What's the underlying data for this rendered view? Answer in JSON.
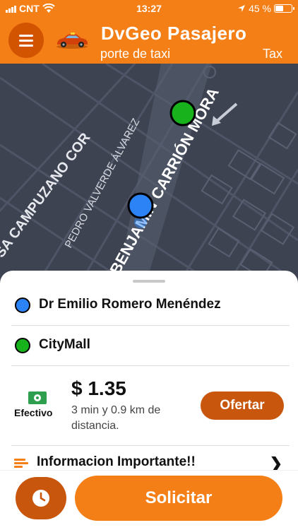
{
  "status_bar": {
    "carrier": "CNT",
    "time": "13:27",
    "battery_text": "45 %",
    "battery_level": 0.45
  },
  "header": {
    "title": "DvGeo Pasajero",
    "marquee_text": "porte de taxi",
    "marquee_text_next": "Tax"
  },
  "map": {
    "street_labels": [
      "ROSA CAMPUZANO COR",
      "PEDRO VALVERDE ÁLVAREZ",
      "BENJAMÍN CARRIÓN MORA"
    ],
    "origin_color": "#2b83f6",
    "destination_color": "#18b21d"
  },
  "trip": {
    "origin": "Dr Emilio Romero Menéndez",
    "destination": "CityMall"
  },
  "fare": {
    "payment_method": "Efectivo",
    "price": "$ 1.35",
    "eta": "3 min y 0.9 km de distancia.",
    "offer_label": "Ofertar"
  },
  "info": {
    "label": "Informacion Importante!!"
  },
  "actions": {
    "request_label": "Solicitar"
  },
  "colors": {
    "accent": "#f57f17",
    "accent_dark": "#c8560d",
    "map_bg": "#3d4350"
  }
}
